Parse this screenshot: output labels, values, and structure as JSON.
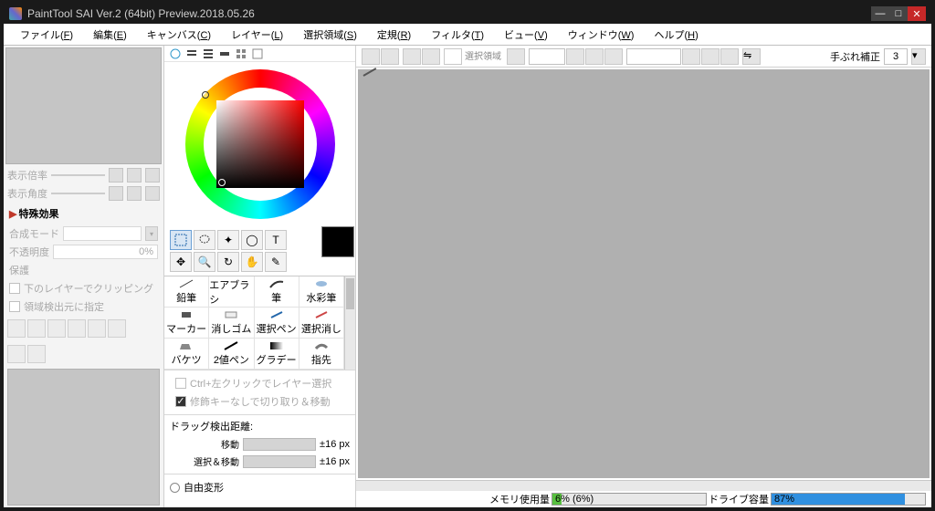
{
  "title": "PaintTool SAI Ver.2 (64bit) Preview.2018.05.26",
  "menu": {
    "file": {
      "label": "ファイル",
      "key": "F"
    },
    "edit": {
      "label": "編集",
      "key": "E"
    },
    "canvas": {
      "label": "キャンバス",
      "key": "C"
    },
    "layer": {
      "label": "レイヤー",
      "key": "L"
    },
    "select": {
      "label": "選択領域",
      "key": "S"
    },
    "ruler": {
      "label": "定規",
      "key": "R"
    },
    "filter": {
      "label": "フィルタ",
      "key": "T"
    },
    "view": {
      "label": "ビュー",
      "key": "V"
    },
    "window": {
      "label": "ウィンドウ",
      "key": "W"
    },
    "help": {
      "label": "ヘルプ",
      "key": "H"
    }
  },
  "left": {
    "zoom_label": "表示倍率",
    "angle_label": "表示角度",
    "fx_header": "特殊効果",
    "blend_label": "合成モード",
    "opacity_label": "不透明度",
    "opacity_value": "0%",
    "protect_label": "保護",
    "clip_label": "下のレイヤーでクリッピング",
    "ref_label": "領域検出元に指定"
  },
  "brushes": {
    "r0": [
      "鉛筆",
      "エアブラシ",
      "筆",
      "水彩筆"
    ],
    "r1": [
      "マーカー",
      "消しゴム",
      "選択ペン",
      "選択消し"
    ],
    "r2": [
      "バケツ",
      "2値ペン",
      "グラデー",
      "指先"
    ]
  },
  "mid": {
    "ctrl_click": "Ctrl+左クリックでレイヤー選択",
    "mod_key": "修飾キーなしで切り取り＆移動",
    "drag_header": "ドラッグ検出距離:",
    "move_label": "移動",
    "move_val": "±16 px",
    "selmove_label": "選択＆移動",
    "selmove_val": "±16 px",
    "freeform": "自由変形"
  },
  "toolbar": {
    "selarea": "選択領域",
    "stabilizer_label": "手ぶれ補正",
    "stabilizer_value": "3"
  },
  "status": {
    "mem_label": "メモリ使用量",
    "mem_value": "6% (6%)",
    "drive_label": "ドライブ容量",
    "drive_value": "87%"
  }
}
